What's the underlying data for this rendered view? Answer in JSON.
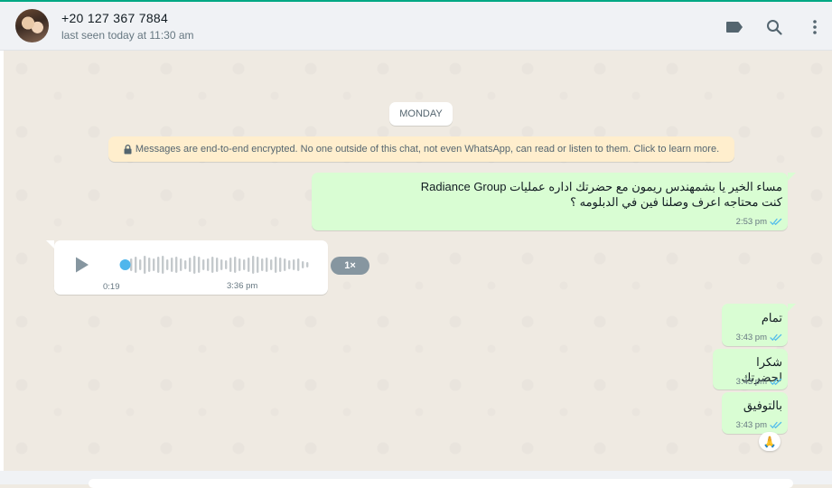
{
  "header": {
    "contact_name": "+20 127 367 7884",
    "status": "last seen today at 11:30 am",
    "icons": [
      "label-icon",
      "search-icon",
      "menu-icon"
    ]
  },
  "chat": {
    "date_chip": "MONDAY",
    "encryption_notice": "Messages are end-to-end encrypted. No one outside of this chat, not even WhatsApp, can read or listen to them. Click to learn more.",
    "messages": [
      {
        "direction": "outgoing",
        "text": "مساء الخير يا بشمهندس ريمون مع حضرتك اداره عمليات Radiance Group\nكنت محتاجه اعرف وصلنا فين في الدبلومه ؟",
        "time": "2:53 pm",
        "status": "read"
      },
      {
        "direction": "incoming",
        "type": "voice",
        "duration": "0:19",
        "time": "3:36 pm",
        "speed": "1×",
        "progress": 0.04
      },
      {
        "direction": "outgoing",
        "text": "تمام",
        "time": "3:43 pm",
        "status": "read"
      },
      {
        "direction": "outgoing",
        "text": "شكرا لحضرتك",
        "time": "3:43 pm",
        "status": "read"
      },
      {
        "direction": "outgoing",
        "text": "بالتوفيق",
        "time": "3:43 pm",
        "status": "read",
        "reaction": "🙏"
      }
    ]
  },
  "colors": {
    "outgoing_bubble": "#d9fdd3",
    "incoming_bubble": "#ffffff",
    "read_ticks": "#53bdeb",
    "accent": "#00a884",
    "chat_background": "#efeae2"
  }
}
